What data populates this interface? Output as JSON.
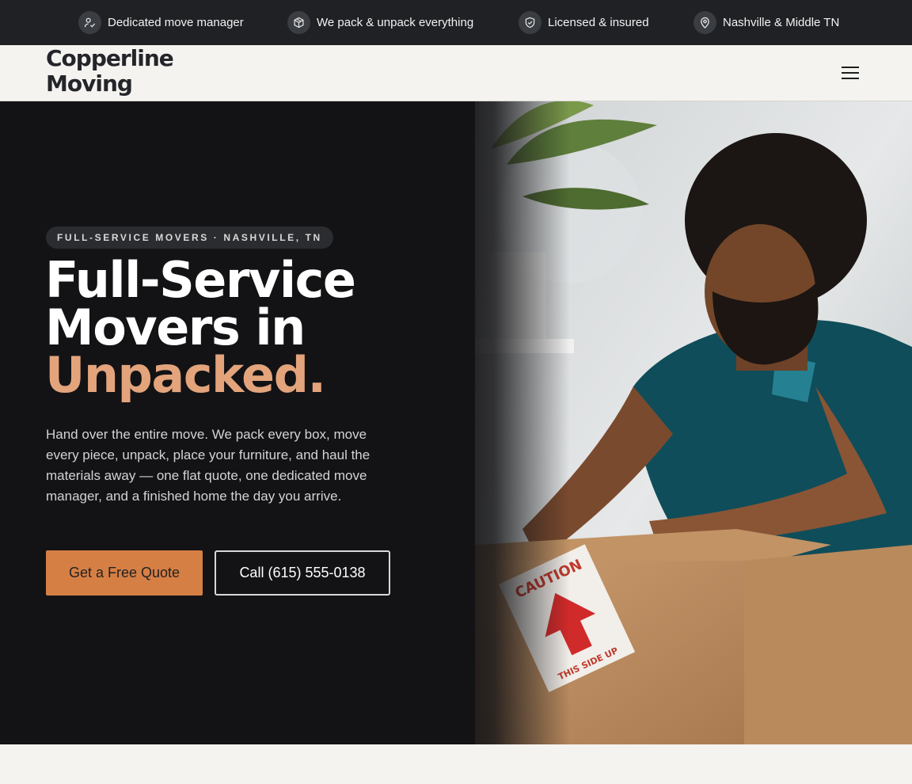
{
  "topbar": {
    "items": [
      {
        "icon": "person-check-icon",
        "label": "Dedicated move manager"
      },
      {
        "icon": "box-icon",
        "label": "We pack & unpack everything"
      },
      {
        "icon": "shield-check-icon",
        "label": "Licensed & insured"
      },
      {
        "icon": "map-pin-icon",
        "label": "Nashville & Middle TN"
      }
    ]
  },
  "header": {
    "logo_line1": "Copperline",
    "logo_line2": "Moving",
    "menu_icon": "hamburger-menu-icon"
  },
  "hero": {
    "eyebrow": "FULL-SERVICE MOVERS · NASHVILLE, TN",
    "headline_line1": "Full-Service",
    "headline_line2": "Movers in",
    "headline_accent": "Unpacked.",
    "lead": "Hand over the entire move. We pack every box, move every piece, unpack, place your furniture, and haul the materials away — one flat quote, one dedicated move manager, and a finished home the day you arrive.",
    "primary_cta": "Get a Free Quote",
    "secondary_cta": "Call (615) 555-0138",
    "image_alt": "Mover unpacking a cardboard box",
    "box_label_top": "CAUTION",
    "box_label_bottom": "THIS SIDE UP"
  },
  "colors": {
    "topbar_bg": "#1f2124",
    "hero_bg": "#131316",
    "accent": "#e3a47c",
    "cta": "#d67f45",
    "page_bg": "#f5f3ef"
  }
}
